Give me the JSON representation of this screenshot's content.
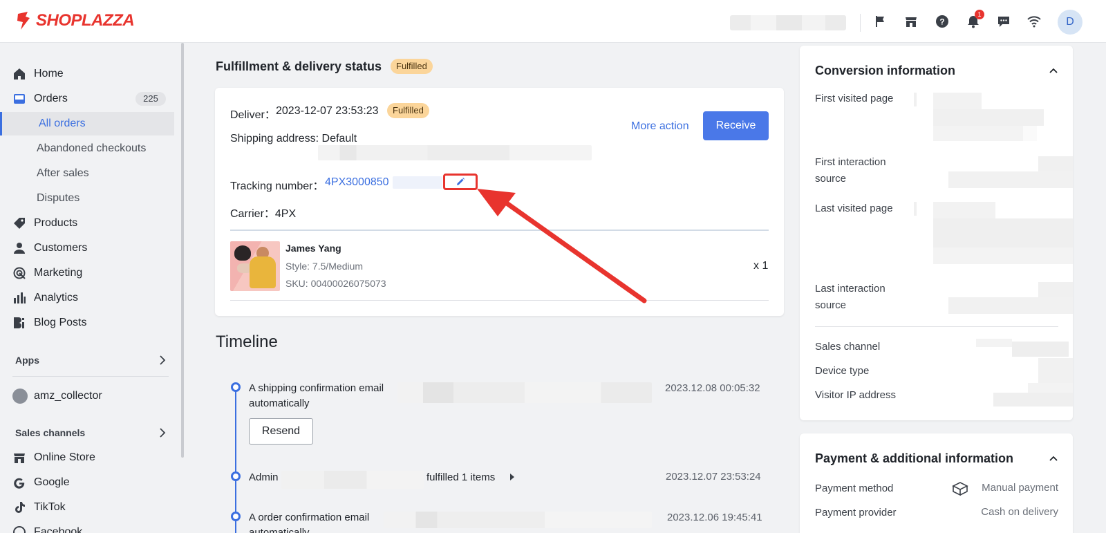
{
  "topbar": {
    "brand": "SHOPLAZZA",
    "icons": [
      "flag-icon",
      "store-icon",
      "help-icon",
      "bell-icon",
      "chat-icon",
      "wifi-icon"
    ],
    "notification_count": "1",
    "avatar_initial": "D"
  },
  "sidebar": {
    "home": "Home",
    "orders": "Orders",
    "orders_count": "225",
    "all_orders": "All orders",
    "abandoned": "Abandoned checkouts",
    "after_sales": "After sales",
    "disputes": "Disputes",
    "products": "Products",
    "customers": "Customers",
    "marketing": "Marketing",
    "analytics": "Analytics",
    "blog_posts": "Blog Posts",
    "apps_title": "Apps",
    "app_item": "amz_collector",
    "sales_channels_title": "Sales channels",
    "online_store": "Online Store",
    "google": "Google",
    "tiktok": "TikTok",
    "facebook": "Facebook"
  },
  "fulfillment": {
    "section_title": "Fulfillment & delivery status",
    "status": "Fulfilled",
    "deliver_label": "Deliver：",
    "deliver_time": "2023-12-07 23:53:23",
    "deliver_status": "Fulfilled",
    "shipping_address": "Shipping address: Default",
    "tracking_label": "Tracking number：",
    "tracking_number": "4PX3000850",
    "carrier": "Carrier：4PX",
    "more_action": "More action",
    "receive": "Receive",
    "item": {
      "name": "James Yang",
      "style": "Style: 7.5/Medium",
      "sku": "SKU: 00400026075073",
      "qty": "x 1"
    }
  },
  "timeline": {
    "title": "Timeline",
    "events": [
      {
        "line1": "A shipping confirmation email",
        "line2": "automatically",
        "time": "2023.12.08 00:05:32"
      },
      {
        "line1": "Admin",
        "line1_suffix": "fulfilled 1 items",
        "time": "2023.12.07 23:53:24"
      },
      {
        "line1": "A order confirmation email",
        "line2": "automatically",
        "time": "2023.12.06 19:45:41"
      }
    ],
    "resend": "Resend"
  },
  "conversion": {
    "title": "Conversion information",
    "first_visited": "First visited page",
    "first_interaction": "First interaction source",
    "last_visited": "Last visited page",
    "last_interaction": "Last interaction source",
    "sales_channel": "Sales channel",
    "device_type": "Device type",
    "visitor_ip": "Visitor IP address"
  },
  "payment": {
    "title": "Payment & additional information",
    "method_label": "Payment method",
    "method_value": "Manual payment",
    "provider_label": "Payment provider",
    "provider_value": "Cash on delivery"
  },
  "colors": {
    "accent": "#3b6fe0",
    "brand": "#e8342e",
    "pill": "#fbd59a"
  }
}
